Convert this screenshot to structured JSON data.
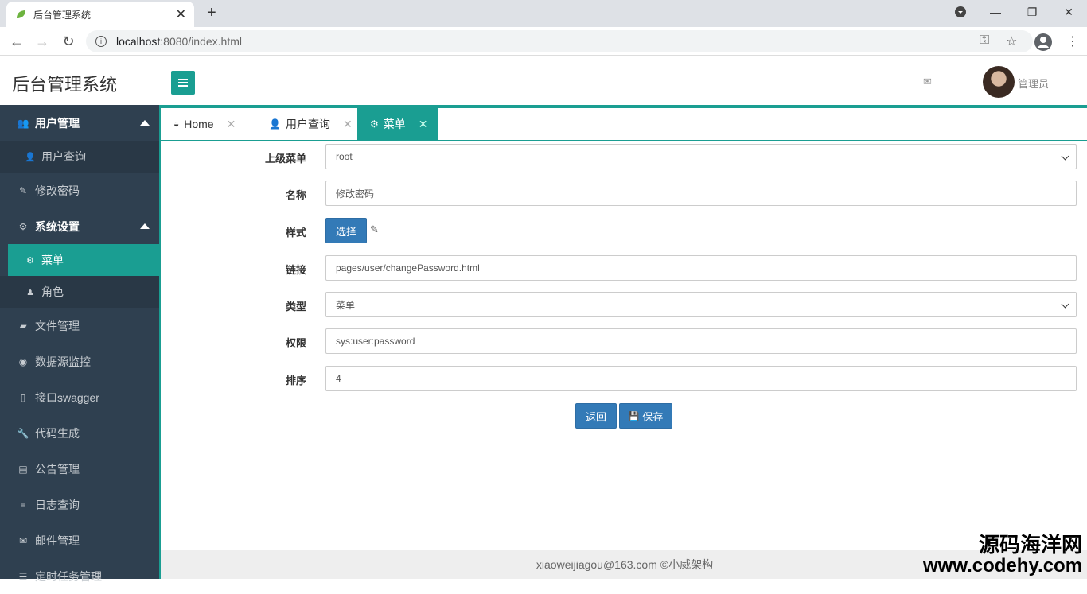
{
  "browser": {
    "tab_title": "后台管理系统",
    "url_host": "localhost",
    "url_rest": ":8080/index.html"
  },
  "header": {
    "app_title": "后台管理系统",
    "user_name": "管理员"
  },
  "sidebar": {
    "items": [
      {
        "label": "用户管理",
        "icon": "users-icon"
      },
      {
        "label": "用户查询",
        "icon": "user-icon"
      },
      {
        "label": "修改密码",
        "icon": "edit-icon"
      },
      {
        "label": "系统设置",
        "icon": "cogs-icon"
      },
      {
        "label": "菜单",
        "icon": "gear-icon"
      },
      {
        "label": "角色",
        "icon": "role-icon"
      },
      {
        "label": "文件管理",
        "icon": "folder-icon"
      },
      {
        "label": "数据源监控",
        "icon": "eye-icon"
      },
      {
        "label": "接口swagger",
        "icon": "pdf-icon"
      },
      {
        "label": "代码生成",
        "icon": "wrench-icon"
      },
      {
        "label": "公告管理",
        "icon": "book-icon"
      },
      {
        "label": "日志查询",
        "icon": "list-icon"
      },
      {
        "label": "邮件管理",
        "icon": "envelope-icon"
      },
      {
        "label": "定时任务管理",
        "icon": "tasks-icon"
      }
    ]
  },
  "tabs": [
    {
      "label": "Home",
      "icon": "dashboard-icon"
    },
    {
      "label": "用户查询",
      "icon": "user-icon"
    },
    {
      "label": "菜单",
      "icon": "gear-icon"
    }
  ],
  "form": {
    "parent_label": "上级菜单",
    "parent_value": "root",
    "name_label": "名称",
    "name_value": "修改密码",
    "style_label": "样式",
    "style_button": "选择",
    "link_label": "链接",
    "link_value": "pages/user/changePassword.html",
    "type_label": "类型",
    "type_value": "菜单",
    "perm_label": "权限",
    "perm_value": "sys:user:password",
    "sort_label": "排序",
    "sort_value": "4",
    "back_button": "返回",
    "save_button": "保存"
  },
  "footer": {
    "text": "xiaoweijiagou@163.com ©小威架构"
  },
  "watermark": {
    "line1": "源码海洋网",
    "line2": "www.codehy.com"
  },
  "colors": {
    "accent": "#1a9e92",
    "sidebar": "#2f4050",
    "primary_button": "#337ab7"
  }
}
